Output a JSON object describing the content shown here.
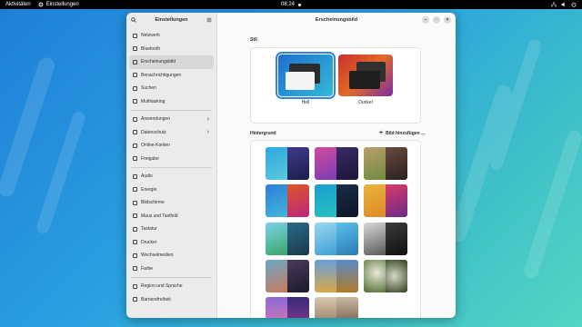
{
  "topbar": {
    "activities": "Aktivitäten",
    "app_name": "Einstellungen",
    "clock": "08:24"
  },
  "sidebar": {
    "title": "Einstellungen",
    "items": [
      {
        "label": "Netzwerk",
        "icon": "network-icon"
      },
      {
        "label": "Bluetooth",
        "icon": "bluetooth-icon"
      },
      {
        "label": "Erscheinungsbild",
        "icon": "appearance-icon",
        "active": true
      },
      {
        "label": "Benachrichtigungen",
        "icon": "bell-icon"
      },
      {
        "label": "Suchen",
        "icon": "search-icon"
      },
      {
        "label": "Multitasking",
        "icon": "multitasking-icon"
      },
      {
        "label": "Anwendungen",
        "icon": "apps-icon",
        "chevron": true
      },
      {
        "label": "Datenschutz",
        "icon": "privacy-icon",
        "chevron": true
      },
      {
        "label": "Online-Konten",
        "icon": "online-accounts-icon"
      },
      {
        "label": "Freigabe",
        "icon": "sharing-icon"
      },
      {
        "label": "Audio",
        "icon": "audio-icon"
      },
      {
        "label": "Energie",
        "icon": "power-icon"
      },
      {
        "label": "Bildschirme",
        "icon": "display-icon"
      },
      {
        "label": "Maus und Tastfeld",
        "icon": "mouse-icon"
      },
      {
        "label": "Tastatur",
        "icon": "keyboard-icon"
      },
      {
        "label": "Drucker",
        "icon": "printer-icon"
      },
      {
        "label": "Wechselmedien",
        "icon": "removable-media-icon"
      },
      {
        "label": "Farbe",
        "icon": "color-icon"
      },
      {
        "label": "Region und Sprache",
        "icon": "region-icon"
      },
      {
        "label": "Barrierefreiheit",
        "icon": "accessibility-icon"
      }
    ]
  },
  "main": {
    "title": "Erscheinungsbild",
    "style_section": "Stil",
    "style_light": "Hell",
    "style_dark": "Dunkel",
    "background_section": "Hintergrund",
    "add_background": "Bild hinzufügen …"
  },
  "colors": {
    "accent": "#3584e4"
  }
}
